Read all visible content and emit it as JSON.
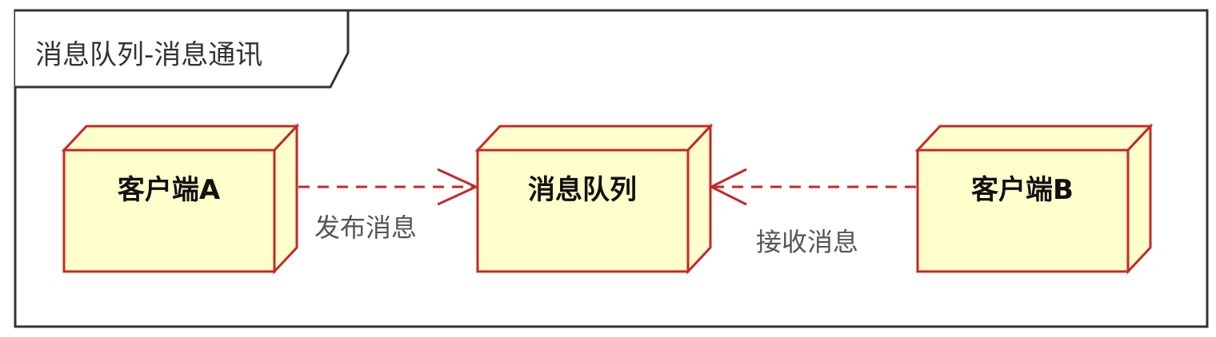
{
  "frame": {
    "title": "消息队列-消息通讯"
  },
  "nodes": {
    "client_a": {
      "label": "客户端A"
    },
    "message_queue": {
      "label": "消息队列"
    },
    "client_b": {
      "label": "客户端B"
    }
  },
  "edges": {
    "publish": {
      "label": "发布消息",
      "from": "客户端A",
      "to": "消息队列"
    },
    "receive": {
      "label": "接收消息",
      "from": "客户端B",
      "to": "消息队列"
    }
  },
  "colors": {
    "node_fill": "#ffffcc",
    "node_stroke": "#c62828",
    "edge_stroke": "#c62828",
    "frame_stroke": "#333333"
  }
}
